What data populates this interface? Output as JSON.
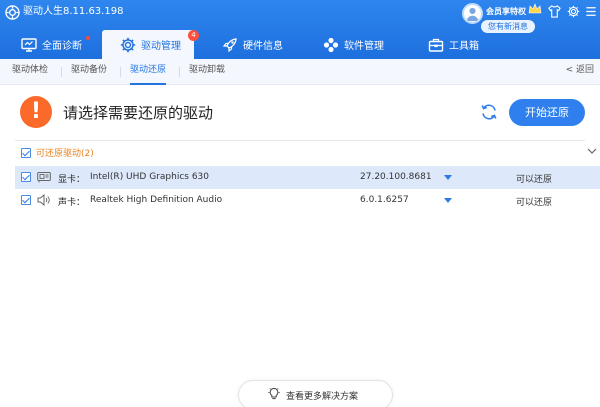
{
  "app": {
    "title": "驱动人生8.11.63.198"
  },
  "account": {
    "vip_label": "会员享特权",
    "new_message": "您有新消息"
  },
  "nav": {
    "items": [
      {
        "label": "全面诊断"
      },
      {
        "label": "驱动管理",
        "badge": "4"
      },
      {
        "label": "硬件信息"
      },
      {
        "label": "软件管理"
      },
      {
        "label": "工具箱"
      }
    ]
  },
  "subnav": {
    "tabs": [
      {
        "label": "驱动体检"
      },
      {
        "label": "驱动备份"
      },
      {
        "label": "驱动还原"
      },
      {
        "label": "驱动卸载"
      }
    ],
    "back_label": "< 返回"
  },
  "main": {
    "warning_symbol": "!",
    "headline": "请选择需要还原的驱动",
    "start_button": "开始还原",
    "group_label": "可还原驱动(2)",
    "drivers": [
      {
        "type": "显卡：",
        "name": "Intel(R) UHD Graphics 630",
        "version": "27.20.100.8681",
        "status": "可以还原",
        "icon": "display-card-icon"
      },
      {
        "type": "声卡：",
        "name": "Realtek High Definition Audio",
        "version": "6.0.1.6257",
        "status": "可以还原",
        "icon": "speaker-icon"
      }
    ],
    "more_button": "查看更多解决方案"
  },
  "colors": {
    "header_blue": "#2374e6",
    "accent_blue": "#2f80ee",
    "warning_orange": "#fb6a2a",
    "group_orange": "#e8821e",
    "selected_row": "#dde9fa"
  }
}
